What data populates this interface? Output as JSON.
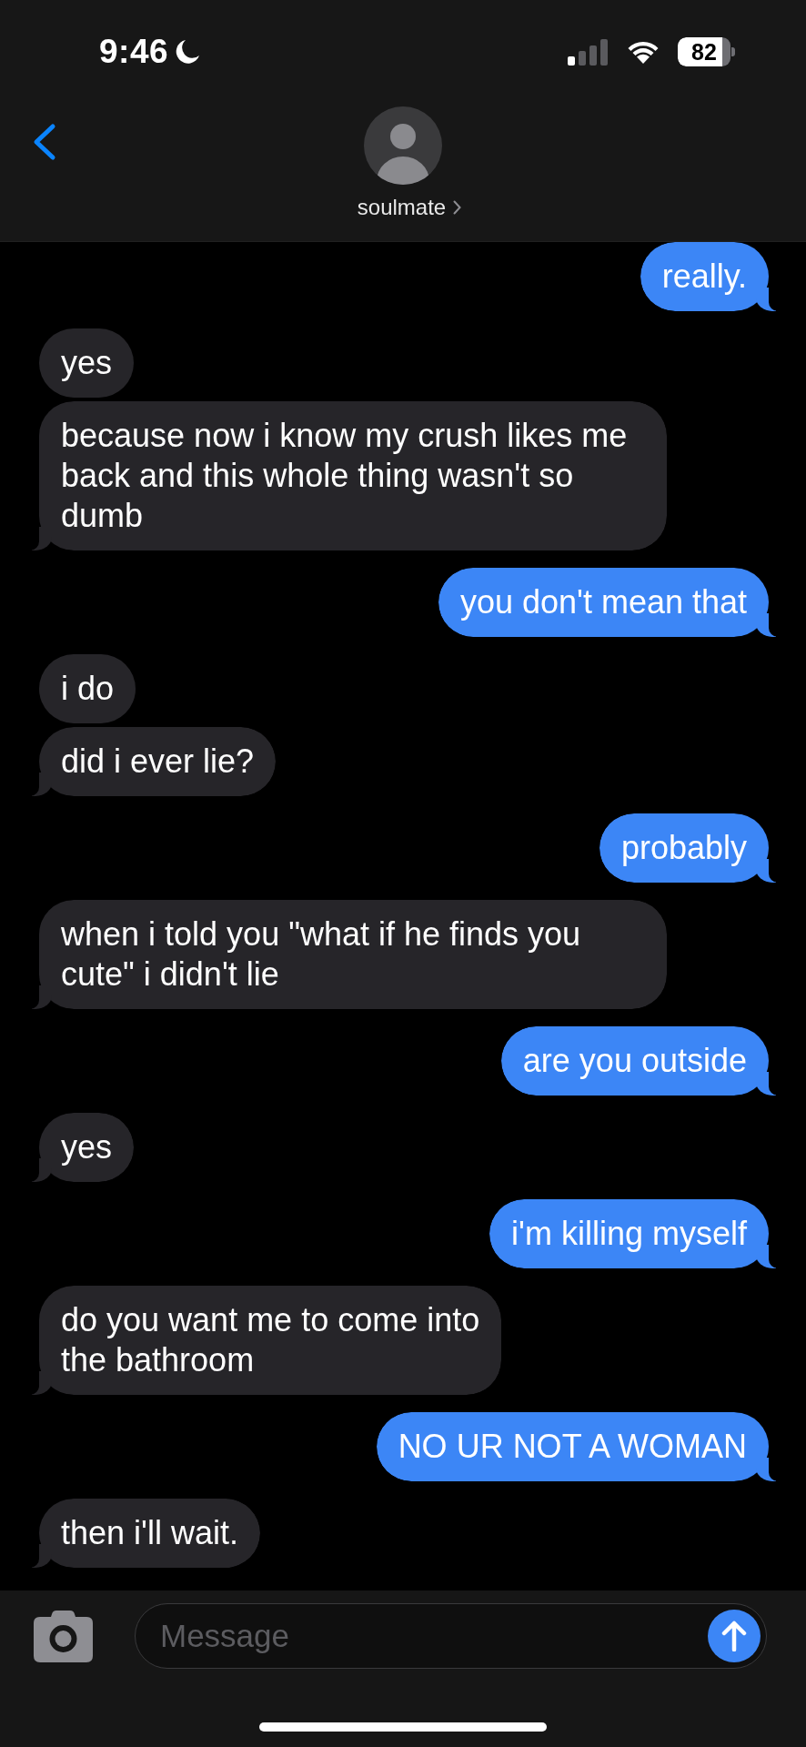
{
  "status_bar": {
    "time": "9:46",
    "battery": "82"
  },
  "header": {
    "contact_name": "soulmate"
  },
  "messages": [
    {
      "kind": "sent",
      "text": "really."
    },
    {
      "kind": "received",
      "text": "yes"
    },
    {
      "kind": "received",
      "text": "because now i know my crush likes me back and this whole thing wasn't so dumb"
    },
    {
      "kind": "sent",
      "text": "you don't mean that"
    },
    {
      "kind": "received",
      "text": "i do"
    },
    {
      "kind": "received",
      "text": "did i ever lie?"
    },
    {
      "kind": "sent",
      "text": "probably"
    },
    {
      "kind": "received",
      "text": "when i told you \"what if he finds you cute\" i didn't lie"
    },
    {
      "kind": "sent",
      "text": "are you outside"
    },
    {
      "kind": "received",
      "text": "yes"
    },
    {
      "kind": "sent",
      "text": "i'm killing myself"
    },
    {
      "kind": "received",
      "text": "do you want me to come into\nthe bathroom"
    },
    {
      "kind": "sent",
      "text": "NO UR NOT A WOMAN"
    },
    {
      "kind": "received",
      "text": "then i'll wait."
    }
  ],
  "composer": {
    "placeholder": "Message"
  }
}
